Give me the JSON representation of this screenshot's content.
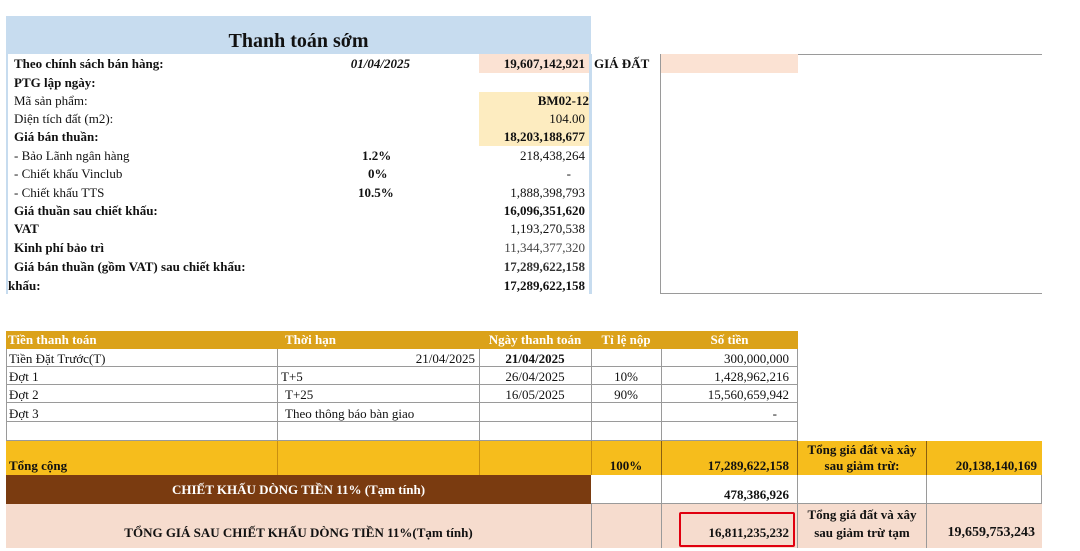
{
  "title": "Thanh toán sớm",
  "summary": {
    "policy_label": "Theo chính sách bán hàng:",
    "policy_date": "01/04/2025",
    "land_value": "19,607,142,921",
    "land_label": "GIÁ ĐẤT",
    "ptg_label": "PTG lập ngày:",
    "product_code_label": "Mã sản phẩm:",
    "product_code": "BM02-12",
    "land_area_label": "Diện tích đất (m2):",
    "land_area": "104.00",
    "net_price_label": "Giá bán thuần:",
    "net_price": "18,203,188,677",
    "bank_guarantee_label": "- Bảo Lãnh ngân hàng",
    "bank_guarantee_pct": "1.2%",
    "bank_guarantee_value": "218,438,264",
    "vinclub_label": "- Chiết khấu Vinclub",
    "vinclub_pct": "0%",
    "vinclub_value": "-",
    "tts_label": "- Chiết khấu TTS",
    "tts_pct": "10.5%",
    "tts_value": "1,888,398,793",
    "after_discount_label": "Giá thuần sau chiết khấu:",
    "after_discount_value": "16,096,351,620",
    "vat_label": "VAT",
    "vat_value": "1,193,270,538",
    "maintenance_label": "Kinh phí bảo trì",
    "maintenance_value": "11,344,377,320",
    "incl_vat_label": "Giá bán thuần (gồm VAT) sau chiết khấu:",
    "incl_vat_value": "17,289,622,158",
    "khau_label": "khấu:",
    "khau_value": "17,289,622,158"
  },
  "schedule": {
    "headers": [
      "Tiền thanh toán",
      "Thời hạn",
      "Ngày thanh toán",
      "Tỉ lệ nộp",
      "Số tiền"
    ],
    "rows": [
      {
        "name": "Tiền Đặt Trước(T)",
        "term": "21/04/2025",
        "date": "21/04/2025",
        "ratio": "",
        "amount": "300,000,000"
      },
      {
        "name": "Đợt 1",
        "term": "T+5",
        "date": "26/04/2025",
        "ratio": "10%",
        "amount": "1,428,962,216"
      },
      {
        "name": "Đợt 2",
        "term": "T+25",
        "date": "16/05/2025",
        "ratio": "90%",
        "amount": "15,560,659,942"
      },
      {
        "name": "Đợt 3",
        "term": "Theo thông báo bàn giao",
        "date": "",
        "ratio": "",
        "amount": "-"
      }
    ],
    "total_label": "Tổng cộng",
    "total_ratio": "100%",
    "total_amount": "17,289,622,158",
    "total_land_label_1": "Tổng giá đất và xây",
    "total_land_label_2": "sau giảm trừ:",
    "total_land_value": "20,138,140,169",
    "cashflow_label": "CHIẾT KHẤU DÒNG TIỀN 11% (Tạm tính)",
    "cashflow_value": "478,386,926",
    "final_label": "TỔNG GIÁ SAU CHIẾT KHẤU DÒNG TIỀN 11%(Tạm tính)",
    "final_value": "16,811,235,232",
    "final_land_label_1": "Tổng giá đất và xây",
    "final_land_label_2": "sau giảm trừ tạm",
    "final_land_value": "19,659,753,243"
  },
  "colors": {
    "header_blue": "#c7dcef",
    "header_gold": "#dba21a",
    "total_orange": "#f6bd1c",
    "cashflow_brown": "#7a3b10",
    "highlight_red": "#e0000f"
  }
}
